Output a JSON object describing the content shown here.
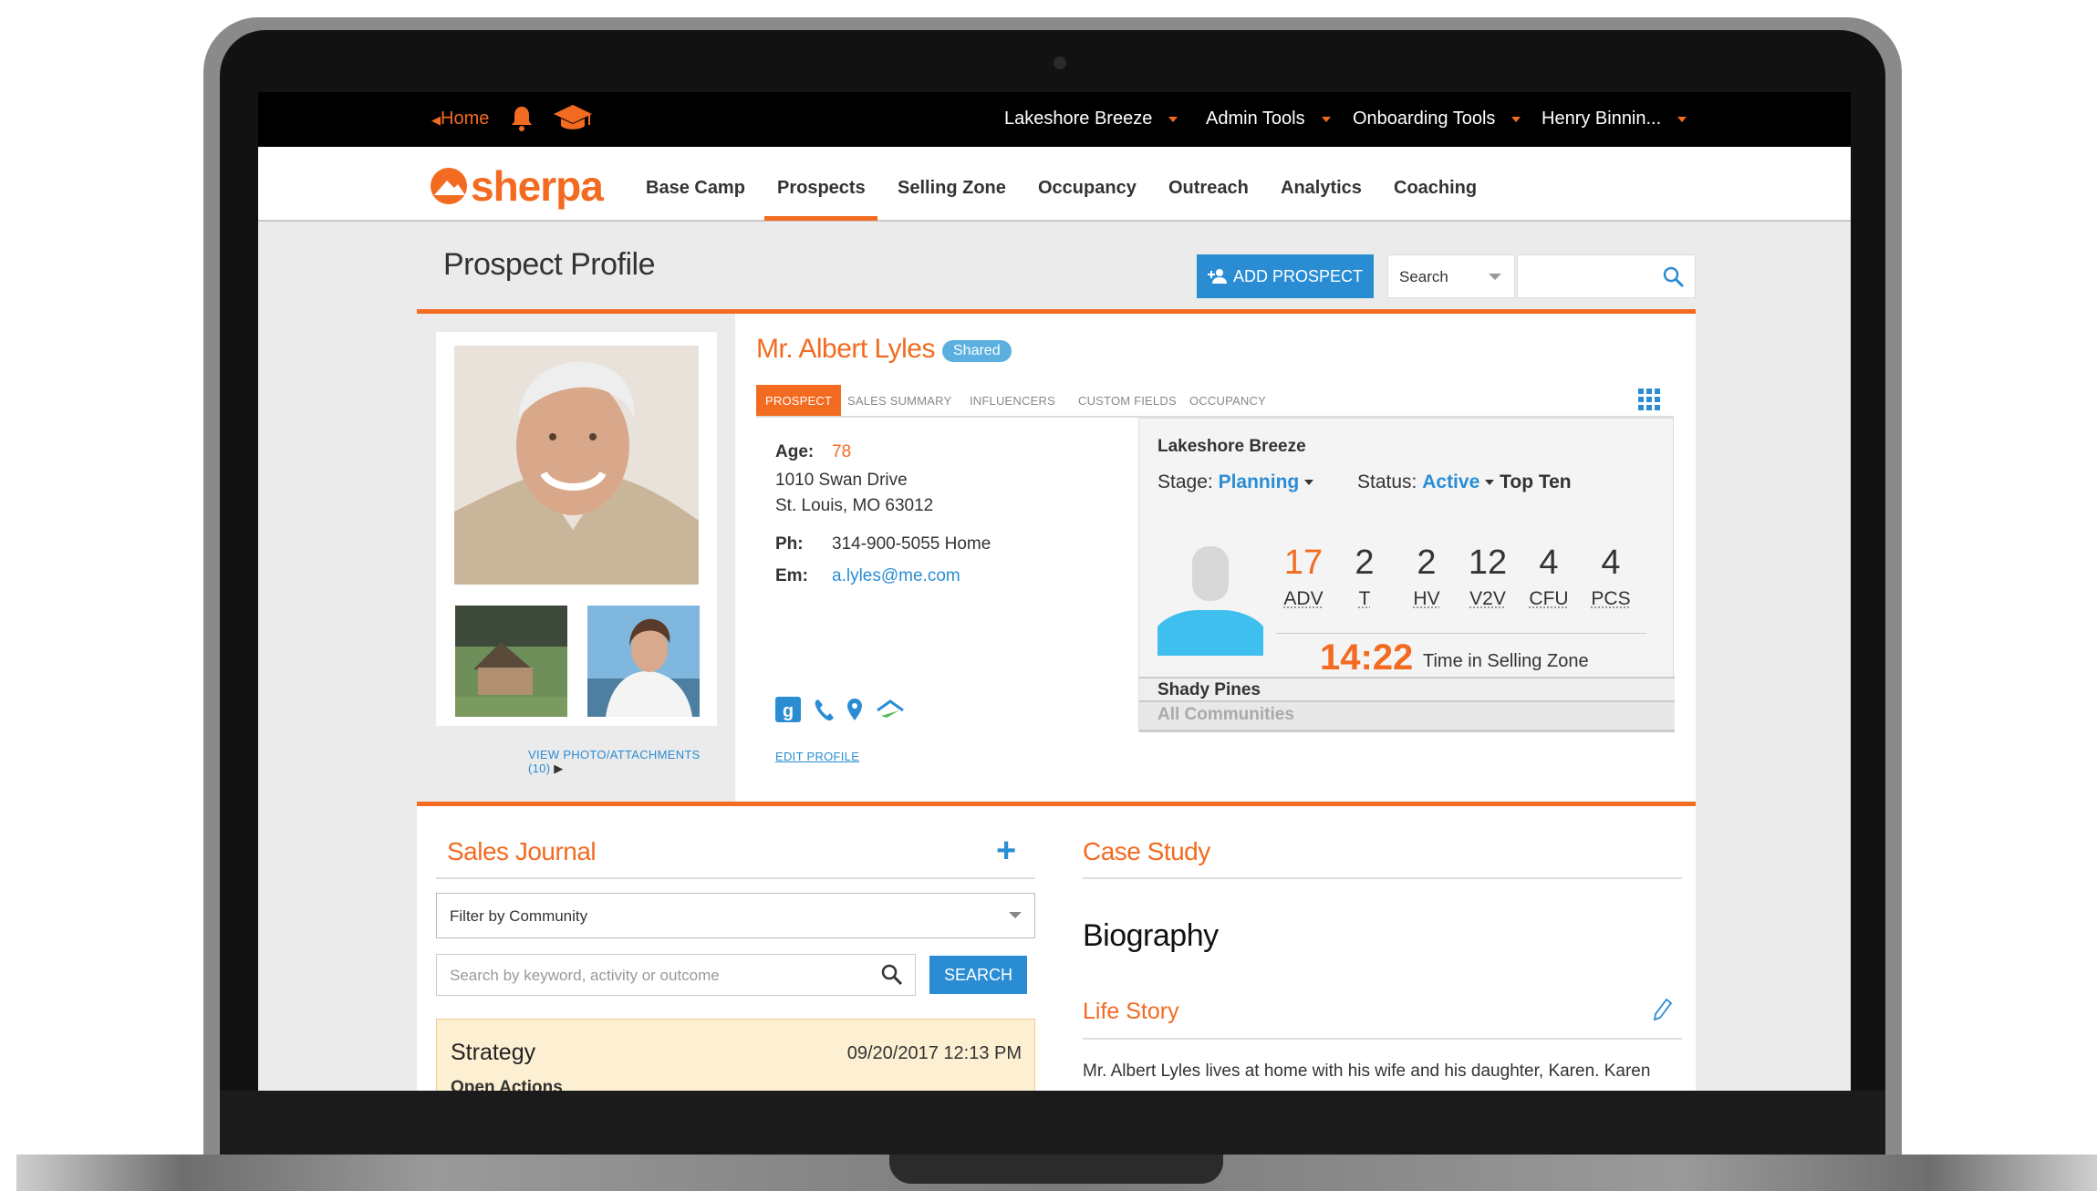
{
  "topbar": {
    "home": "Home",
    "menus": [
      "Lakeshore Breeze",
      "Admin Tools",
      "Onboarding Tools",
      "Henry Binnin..."
    ]
  },
  "brand": {
    "logo": "sherpa",
    "accent": "#f26b21",
    "blue": "#2a8dd4"
  },
  "nav": {
    "items": [
      "Base Camp",
      "Prospects",
      "Selling Zone",
      "Occupancy",
      "Outreach",
      "Analytics",
      "Coaching"
    ],
    "active": "Prospects"
  },
  "header": {
    "title": "Prospect Profile",
    "add_button": "ADD PROSPECT",
    "search_select": "Search",
    "search_placeholder": ""
  },
  "profile": {
    "view_photos": "VIEW PHOTO/ATTACHMENTS (10)",
    "name": "Mr. Albert Lyles",
    "badge": "Shared",
    "tabs": [
      "PROSPECT",
      "SALES SUMMARY",
      "INFLUENCERS",
      "CUSTOM FIELDS",
      "OCCUPANCY"
    ],
    "age_label": "Age:",
    "age": "78",
    "address1": "1010 Swan Drive",
    "address2": "St. Louis, MO 63012",
    "phone_label": "Ph:",
    "phone": "314-900-5055 Home",
    "email_label": "Em:",
    "email": "a.lyles@me.com",
    "edit": "EDIT PROFILE"
  },
  "community": {
    "name": "Lakeshore Breeze",
    "stage_label": "Stage:",
    "stage": "Planning",
    "status_label": "Status:",
    "status": "Active",
    "top_ten": "Top Ten",
    "metrics": [
      {
        "value": "17",
        "label": "ADV"
      },
      {
        "value": "2",
        "label": "T"
      },
      {
        "value": "2",
        "label": "HV"
      },
      {
        "value": "12",
        "label": "V2V"
      },
      {
        "value": "4",
        "label": "CFU"
      },
      {
        "value": "4",
        "label": "PCS"
      }
    ],
    "time": "14:22",
    "time_label": "Time in Selling Zone",
    "other1": "Shady Pines",
    "other2": "All Communities"
  },
  "journal": {
    "title": "Sales Journal",
    "filter": "Filter by Community",
    "search_placeholder": "Search by keyword, activity or outcome",
    "search_button": "SEARCH",
    "entry_title": "Strategy",
    "entry_date": "09/20/2017 12:13 PM",
    "entry_sub": "Open Actions"
  },
  "case_study": {
    "title": "Case Study",
    "biography": "Biography",
    "life_story": "Life Story",
    "text": "Mr. Albert Lyles lives at home with his wife and his daughter, Karen. Karen"
  }
}
